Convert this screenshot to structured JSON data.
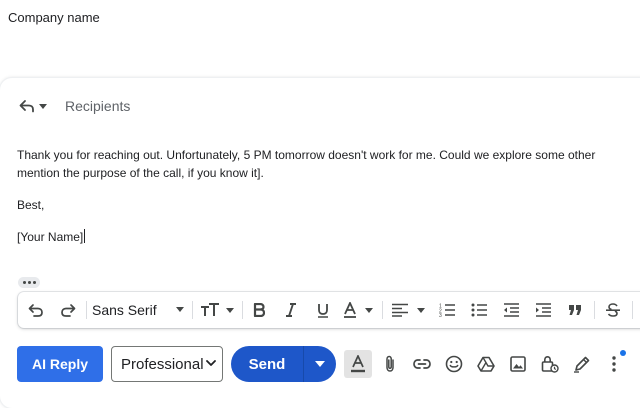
{
  "header": {
    "company_name": "Company name"
  },
  "compose": {
    "recipients_label": "Recipients",
    "body": {
      "line1": "Thank you for reaching out. Unfortunately, 5 PM tomorrow doesn't work for me. Could we explore some other",
      "line2": "mention the purpose of the call, if you know it].",
      "closing": "Best,",
      "signature": "[Your Name]"
    }
  },
  "toolbar": {
    "font_family": "Sans Serif",
    "icons": [
      "undo-icon",
      "redo-icon",
      "font-size-icon",
      "bold-icon",
      "italic-icon",
      "underline-icon",
      "text-color-icon",
      "align-icon",
      "numbered-list-icon",
      "bulleted-list-icon",
      "indent-less-icon",
      "indent-more-icon",
      "quote-icon",
      "strikethrough-icon"
    ]
  },
  "actions": {
    "ai_reply_label": "AI Reply",
    "tone_options": [
      "Professional"
    ],
    "tone_selected": "Professional",
    "send_label": "Send",
    "icons": [
      "text-format-icon",
      "attach-icon",
      "link-icon",
      "emoji-icon",
      "drive-icon",
      "photo-icon",
      "confidential-lock-icon",
      "signature-pen-icon",
      "more-vert-icon"
    ]
  },
  "colors": {
    "accent_blue": "#2f6fe8",
    "send_blue": "#1e57c9",
    "icon_gray": "#444746",
    "notification_dot": "#1a73e8"
  }
}
